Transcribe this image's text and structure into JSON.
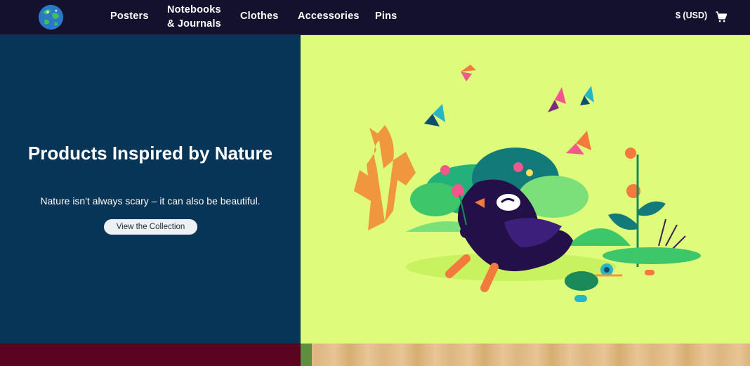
{
  "nav": {
    "items": [
      {
        "label": "Posters"
      },
      {
        "label": "Notebooks\n& Journals"
      },
      {
        "label": "Clothes"
      },
      {
        "label": "Accessories"
      },
      {
        "label": "Pins"
      }
    ],
    "currency": "$ (USD)",
    "logo_icon": "globe-logo-icon",
    "cart_icon": "shopping-cart-icon"
  },
  "hero": {
    "title": "Products Inspired by Nature",
    "subtitle": "Nature isn't always scary – it can also be beautiful.",
    "cta_label": "View the Collection",
    "illustration": "nature-bird-illustration"
  },
  "colors": {
    "nav_bg": "#14112f",
    "hero_left_bg": "#063558",
    "hero_right_bg": "#dffb7c",
    "strip_left_bg": "#5a0422"
  }
}
